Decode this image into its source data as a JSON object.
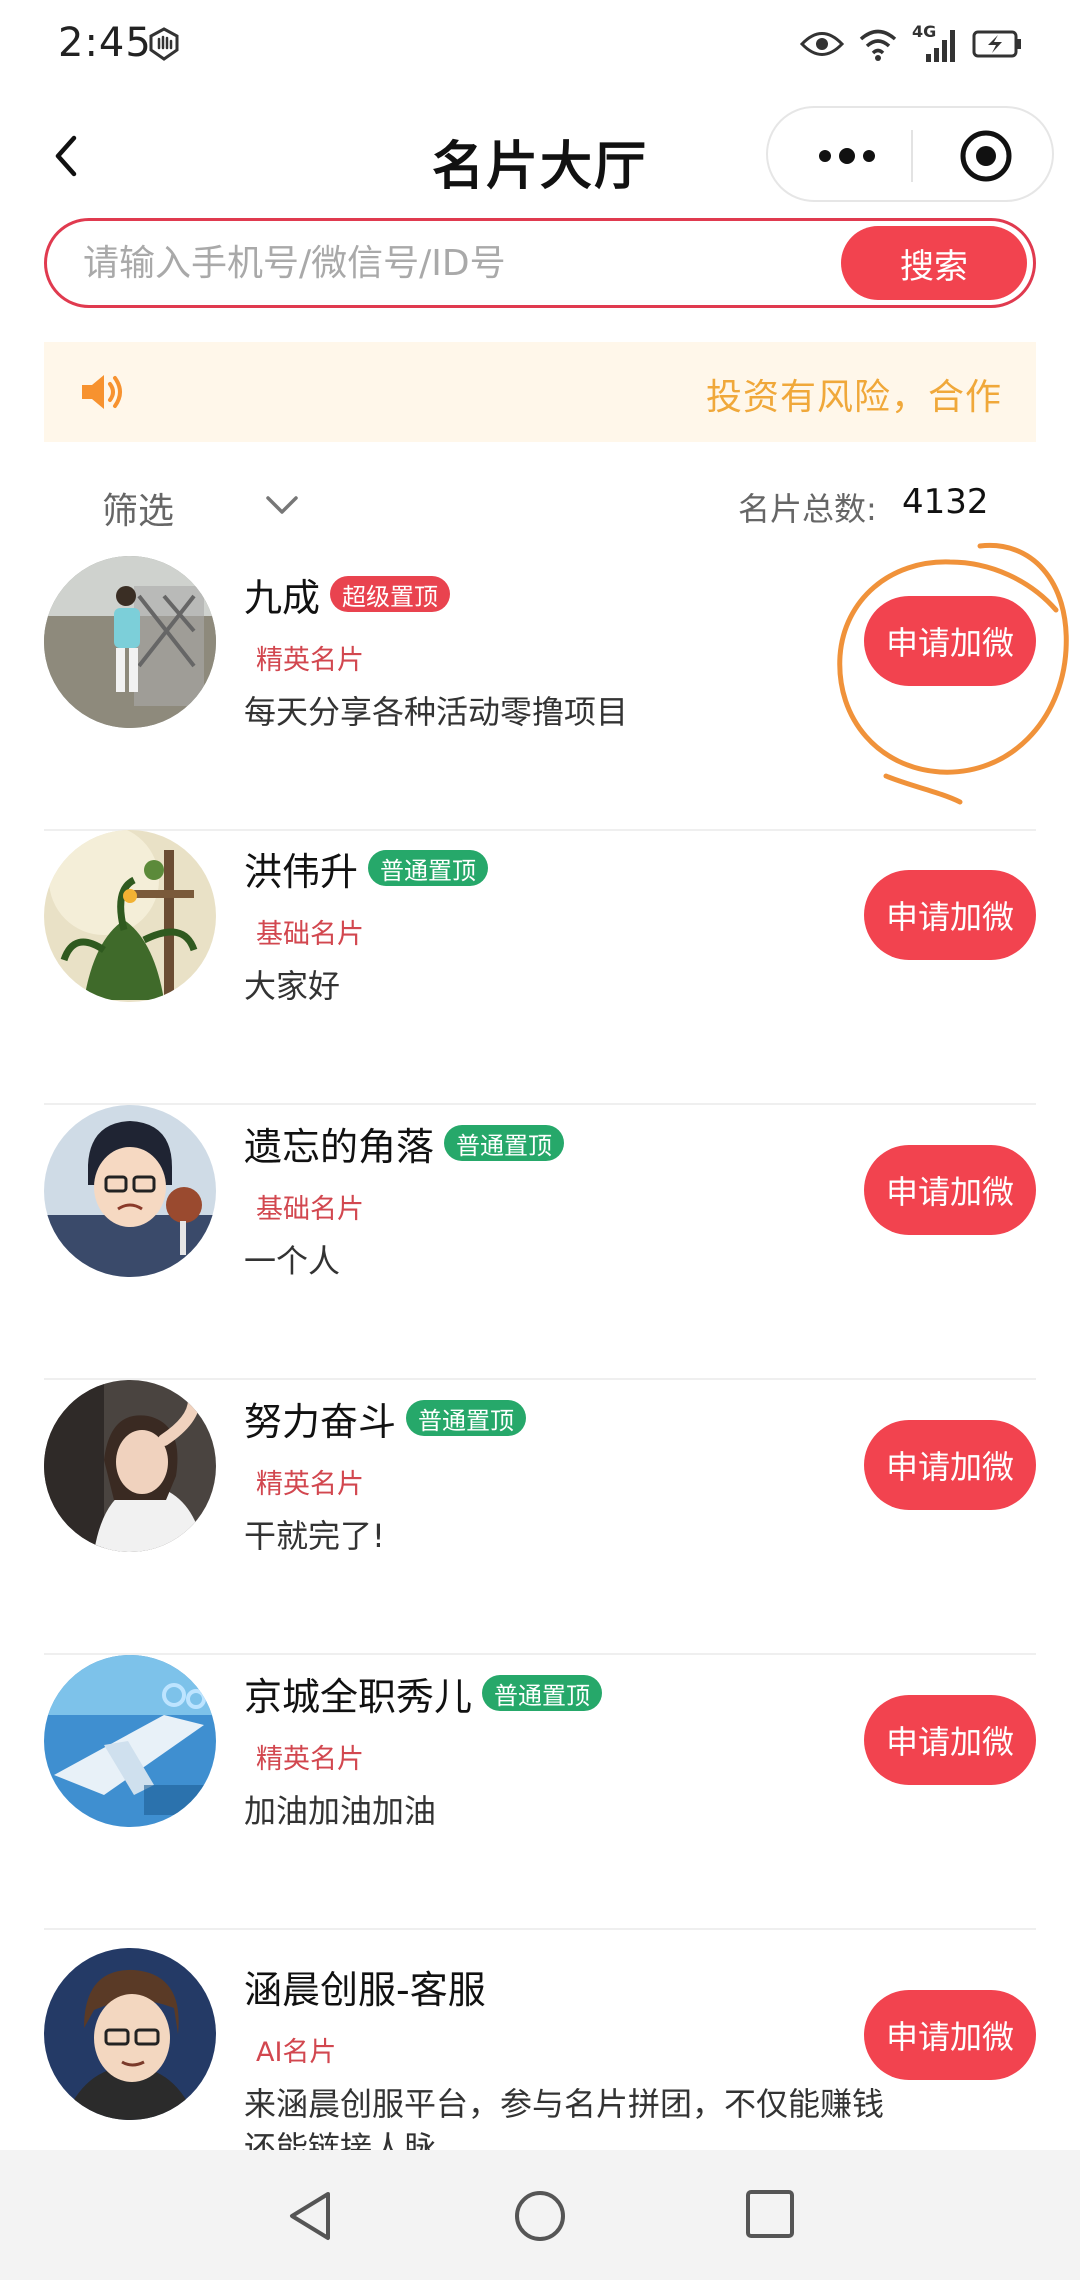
{
  "status_bar": {
    "time": "2:45",
    "network": "4G"
  },
  "header": {
    "title": "名片大厅"
  },
  "search": {
    "placeholder": "请输入手机号/微信号/ID号",
    "value": "",
    "button_label": "搜索"
  },
  "notice": {
    "text": "投资有风险，合作"
  },
  "filter": {
    "label": "筛选",
    "total_label": "名片总数:",
    "total_count": "4132"
  },
  "cards": [
    {
      "name": "九成",
      "badge": "超级置顶",
      "badge_color": "#e9434f",
      "tier": "精英名片",
      "desc": "每天分享各种活动零撸项目",
      "button": "申请加微"
    },
    {
      "name": "洪伟升",
      "badge": "普通置顶",
      "badge_color": "#26a86a",
      "tier": "基础名片",
      "desc": "大家好",
      "button": "申请加微"
    },
    {
      "name": "遗忘的角落",
      "badge": "普通置顶",
      "badge_color": "#26a86a",
      "tier": "基础名片",
      "desc": "一个人",
      "button": "申请加微"
    },
    {
      "name": "努力奋斗",
      "badge": "普通置顶",
      "badge_color": "#26a86a",
      "tier": "精英名片",
      "desc": "干就完了!",
      "button": "申请加微"
    },
    {
      "name": "京城全职秀儿",
      "badge": "普通置顶",
      "badge_color": "#26a86a",
      "tier": "精英名片",
      "desc": "加油加油加油",
      "button": "申请加微"
    },
    {
      "name": "涵晨创服-客服",
      "badge": "",
      "tier": "AI名片",
      "desc": "来涵晨创服平台，参与名片拼团，不仅能赚钱还能链接人脉",
      "button": "申请加微"
    }
  ],
  "colors": {
    "accent": "#f2434f",
    "notice_text": "#f0a83a",
    "tier_text": "#d2474f",
    "annotation": "#f0923a"
  },
  "icons": [
    "back-arrow-icon",
    "more-dots-icon",
    "target-icon",
    "speaker-icon",
    "chevron-down-icon",
    "nav-back-icon",
    "nav-home-icon",
    "nav-recents-icon"
  ]
}
